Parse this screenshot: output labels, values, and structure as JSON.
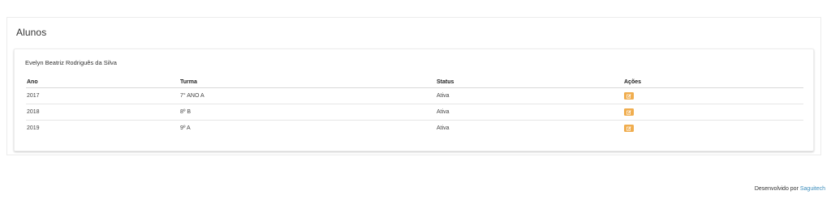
{
  "panel": {
    "title": "Alunos"
  },
  "student": {
    "name": "Evelyn Beatriz Rodriguês da Silva"
  },
  "table": {
    "headers": [
      "Ano",
      "Turma",
      "Status",
      "Ações"
    ],
    "rows": [
      {
        "ano": "2017",
        "turma": "7° ANO A",
        "status": "Ativa",
        "action_icon": "edit-icon"
      },
      {
        "ano": "2018",
        "turma": "8º B",
        "status": "Ativa",
        "action_icon": "edit-icon"
      },
      {
        "ano": "2019",
        "turma": "9º A",
        "status": "Ativa",
        "action_icon": "edit-icon"
      }
    ]
  },
  "colors": {
    "edit_button": "#f0ad4e",
    "link": "#3c8dbc"
  },
  "footer": {
    "prefix": "Desenvolvido por",
    "link_text": "Saguitech"
  }
}
